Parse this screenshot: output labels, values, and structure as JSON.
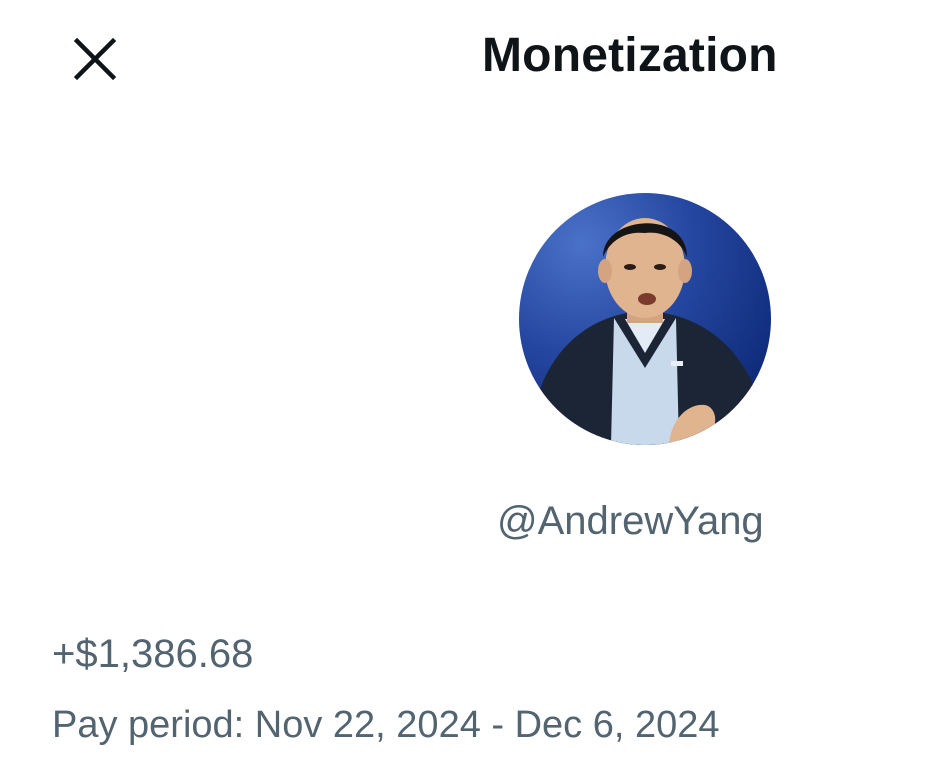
{
  "header": {
    "title": "Monetization",
    "close_icon": "close-icon"
  },
  "profile": {
    "handle": "@AndrewYang",
    "avatar_icon": "avatar-photo"
  },
  "earnings": {
    "amount": "+$1,386.68",
    "pay_period": "Pay period: Nov 22, 2024 - Dec 6, 2024"
  },
  "colors": {
    "text_primary": "#0f1419",
    "text_secondary": "#536471",
    "background": "#ffffff"
  }
}
